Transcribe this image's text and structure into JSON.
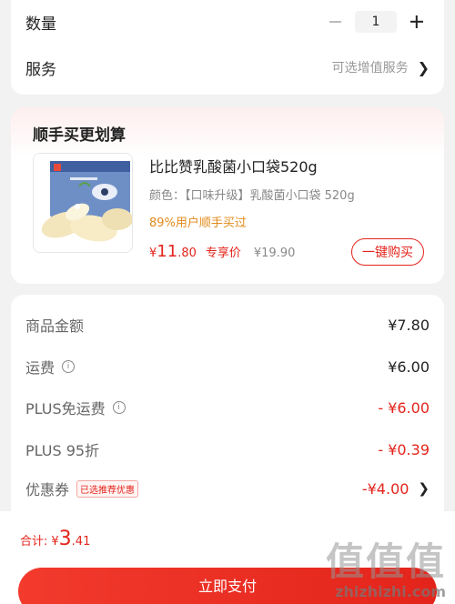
{
  "order": {
    "quantity_label": "数量",
    "quantity_value": "1",
    "service_label": "服务",
    "service_option": "可选增值服务"
  },
  "bundle": {
    "title": "顺手买更划算",
    "product_name": "比比赞乳酸菌小口袋520g",
    "product_spec": "颜色：【口味升级】乳酸菌小口袋 520g",
    "hint": "89%用户顺手买过",
    "price_currency": "¥",
    "price_integer": "11",
    "price_decimal": ".80",
    "price_tag": "专享价",
    "original_price": "¥19.90",
    "buy_label": "一键购买"
  },
  "summary": [
    {
      "label": "商品金额",
      "value": "¥7.80"
    },
    {
      "label": "运费",
      "value": "¥6.00"
    },
    {
      "label": "PLUS免运费",
      "value": "- ¥6.00"
    },
    {
      "label": "PLUS 95折",
      "value": "- ¥0.39"
    },
    {
      "label": "优惠券",
      "value": "-¥4.00",
      "badge": "已选推荐优惠"
    }
  ],
  "footer": {
    "total_label": "合计:",
    "total_currency": "¥",
    "total_integer": "3",
    "total_decimal": ".41",
    "pay_label": "立即支付"
  },
  "watermark": {
    "logo": "值值值",
    "url": "zhizhizhi.com"
  },
  "colors": {
    "accent": "#e3241b",
    "hint_orange": "#e28a1a",
    "background": "#f2f2f2"
  },
  "icons": [
    "minus-icon",
    "plus-icon",
    "chevron-right-icon",
    "info-icon"
  ]
}
